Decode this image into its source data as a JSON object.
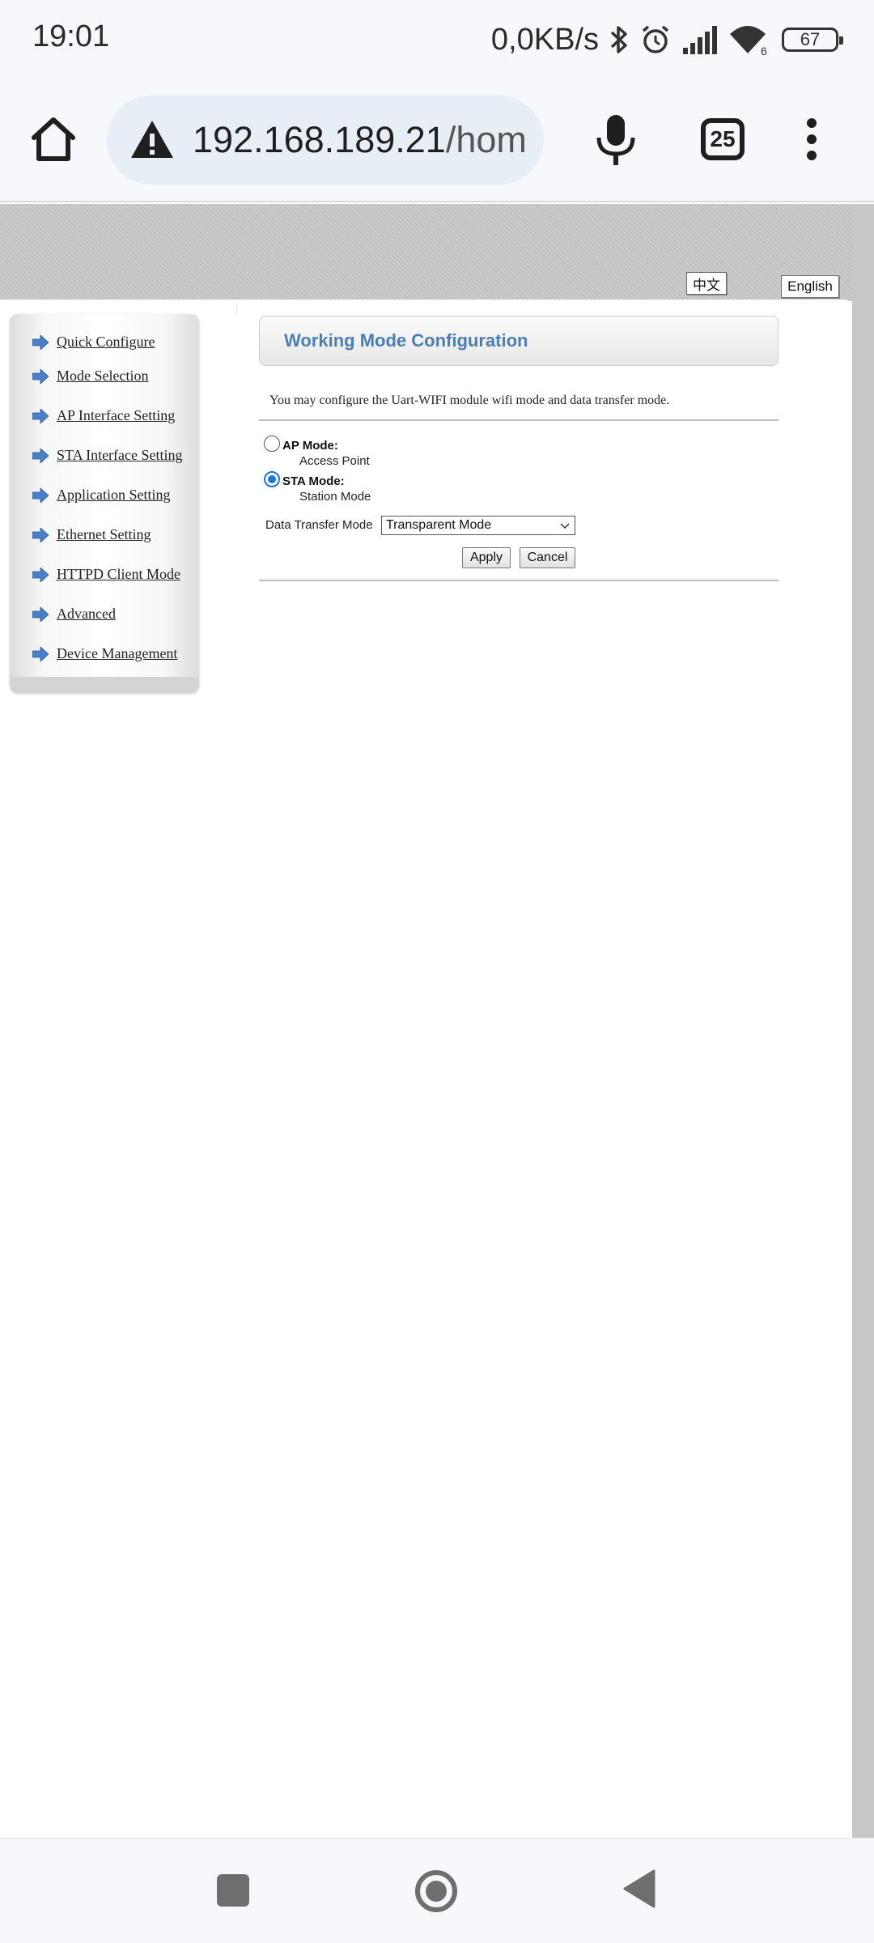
{
  "status_bar": {
    "time": "19:01",
    "net_speed": "0,0KB/s",
    "battery": "67",
    "wifi_badge": "6",
    "icons": [
      "bluetooth-icon",
      "alarm-icon",
      "signal-icon",
      "wifi-icon",
      "battery-icon"
    ]
  },
  "browser": {
    "url_host": "192.168.189.21",
    "url_path": "/home",
    "tab_count": "25",
    "icons": [
      "home-icon",
      "warning-icon",
      "mic-icon",
      "tabs-icon",
      "menu-icon"
    ]
  },
  "page": {
    "lang_zh": "中文",
    "lang_en": "English",
    "sidebar": {
      "items": [
        {
          "label": "Quick Configure"
        },
        {
          "label": "Mode Selection"
        },
        {
          "label": "AP Interface Setting"
        },
        {
          "label": "STA Interface Setting"
        },
        {
          "label": "Application Setting"
        },
        {
          "label": "Ethernet Setting"
        },
        {
          "label": "HTTPD Client Mode"
        },
        {
          "label": "Advanced"
        },
        {
          "label": "Device Management"
        }
      ]
    },
    "main": {
      "title": "Working Mode Configuration",
      "description": "You may configure the Uart-WIFI module wifi mode and data transfer mode.",
      "ap_mode": {
        "label": "AP Mode:",
        "sub": "Access Point",
        "checked": false
      },
      "sta_mode": {
        "label": "STA Mode:",
        "sub": "Station Mode",
        "checked": true
      },
      "data_transfer_label": "Data Transfer Mode",
      "data_transfer_value": "Transparent Mode",
      "apply_label": "Apply",
      "cancel_label": "Cancel"
    },
    "colors": {
      "title": "#4a7fb5",
      "nav_arrow": "#4a7fc8",
      "radio_checked": "#1a73e8"
    }
  },
  "navbar": {
    "icons": [
      "recents-icon",
      "home-circle-icon",
      "back-icon"
    ]
  }
}
